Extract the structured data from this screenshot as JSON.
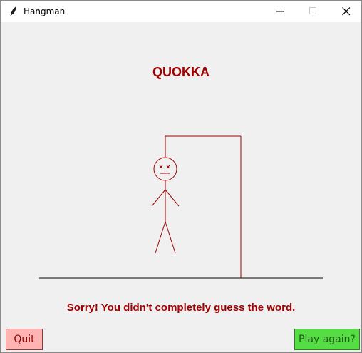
{
  "window": {
    "title": "Hangman",
    "controls": [
      "minimize-icon",
      "maximize-icon",
      "close-icon"
    ]
  },
  "game": {
    "word": "QUOKKA",
    "message": "Sorry! You didn't completely guess the word."
  },
  "buttons": {
    "quit_label": "Quit",
    "play_again_label": "Play again?"
  },
  "colors": {
    "text_red": "#a00000",
    "gallows": "#a00000",
    "quit_bg": "#ffb3b3",
    "play_bg": "#55dd44",
    "background": "#f0f0f0"
  }
}
